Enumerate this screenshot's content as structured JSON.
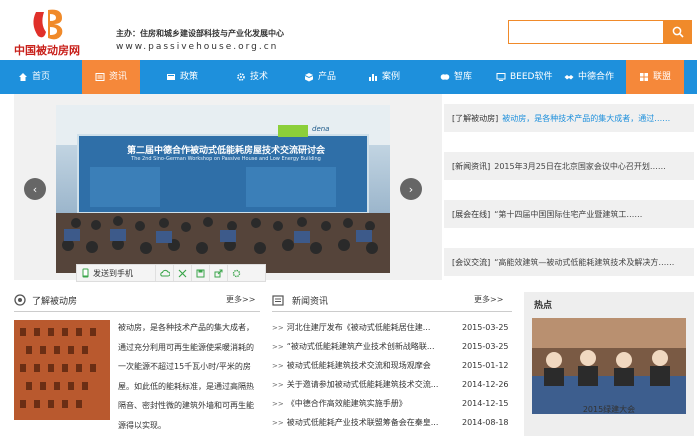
{
  "header": {
    "logo_text": "中国被动房网",
    "sponsor": "主办：住房和城乡建设部科技与产业化发展中心",
    "url": "www.passivehouse.org.cn",
    "search_placeholder": ""
  },
  "nav": {
    "items": [
      {
        "label": "首页",
        "icon": "home-icon",
        "active": false
      },
      {
        "label": "资讯",
        "icon": "news-icon",
        "active": true
      },
      {
        "label": "政策",
        "icon": "policy-icon",
        "active": false
      },
      {
        "label": "技术",
        "icon": "gear-icon",
        "active": false
      },
      {
        "label": "产品",
        "icon": "product-icon",
        "active": false
      },
      {
        "label": "案例",
        "icon": "chart-icon",
        "active": false
      },
      {
        "label": "智库",
        "icon": "brain-icon",
        "active": false
      },
      {
        "label": "BEED软件",
        "icon": "software-icon",
        "active": false
      },
      {
        "label": "中德合作",
        "icon": "handshake-icon",
        "active": false
      },
      {
        "label": "联盟",
        "icon": "alliance-icon",
        "active": true
      }
    ]
  },
  "slider": {
    "banner_title": "第二届中德合作被动式低能耗房屋技术交流研讨会",
    "banner_subtitle": "The 2nd Sino-German Workshop on Passive House and Low Energy Building",
    "banner_logo": "dena",
    "share_label": "发送到手机"
  },
  "right_news": [
    {
      "category": "[了解被动房]",
      "text": "被动房，是各种技术产品的集大成者，通过……"
    },
    {
      "category": "[新闻资讯]",
      "text": "2015年3月25日在北京国家会议中心召开划……"
    },
    {
      "category": "[展会在线]",
      "text": "“第十四届中国国际住宅产业暨建筑工……"
    },
    {
      "category": "[会议交流]",
      "text": "“高能效建筑—被动式低能耗建筑技术及解决方……"
    }
  ],
  "about": {
    "title": "了解被动房",
    "more": "更多>>",
    "text": "被动房，是各种技术产品的集大成者，通过充分利用可再生能源使采暖消耗的一次能源不超过15千瓦小时/平米的房屋。如此低的能耗标准，是通过高隔热隔音、密封性微的建筑外墙和可再生能源得以实现。"
  },
  "news": {
    "title": "新闻资讯",
    "more": "更多>>",
    "rows": [
      {
        "title": "河北住建厅发布《被动式低能耗居住建...",
        "date": "2015-03-25"
      },
      {
        "title": "“被动式低能耗建筑产业技术创新战略联...",
        "date": "2015-03-25"
      },
      {
        "title": "被动式低能耗建筑技术交流和现场观摩会",
        "date": "2015-01-12"
      },
      {
        "title": "关于邀请参加被动式低能耗建筑技术交流...",
        "date": "2014-12-26"
      },
      {
        "title": "《中德合作高效能建筑实施手册》",
        "date": "2014-12-15"
      },
      {
        "title": "被动式低能耗产业技术联盟筹备会在秦皇...",
        "date": "2014-08-18"
      }
    ]
  },
  "hot": {
    "title": "热点",
    "caption": "2015绿建大会"
  },
  "colors": {
    "nav_blue": "#1e90dc",
    "accent_orange": "#f5883a",
    "brand_red": "#c8201a"
  }
}
